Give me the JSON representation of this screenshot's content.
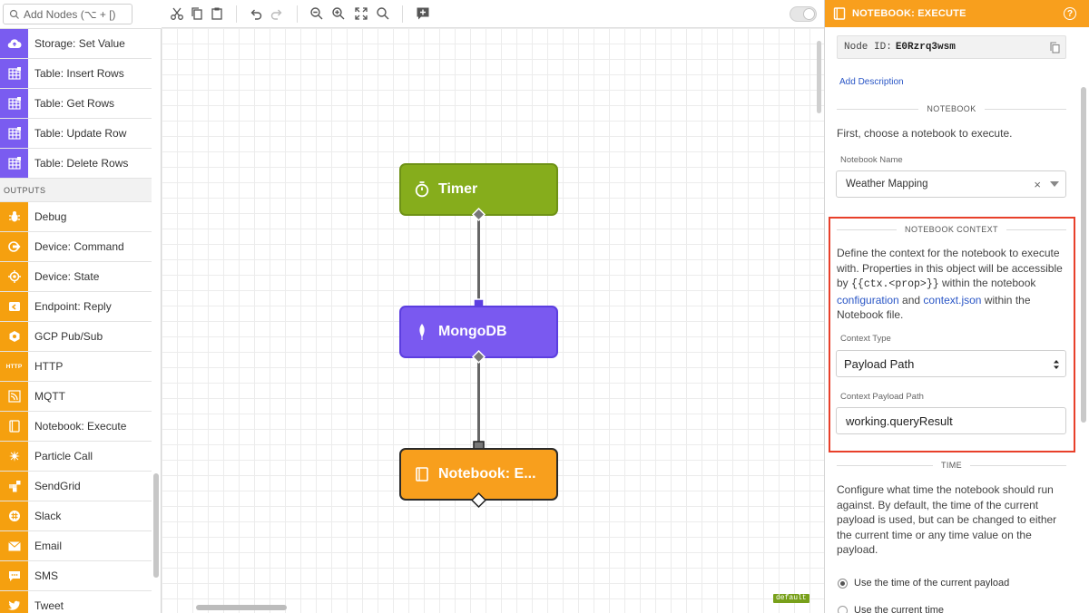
{
  "search": {
    "placeholder": "Add Nodes (⌥ + [)"
  },
  "palette": {
    "items_top": [
      {
        "label": "Storage: Set Value",
        "icon": "cloud-upload-icon",
        "color": "#7a5cf0"
      },
      {
        "label": "Table: Insert Rows",
        "icon": "table-icon",
        "color": "#7a5cf0"
      },
      {
        "label": "Table: Get Rows",
        "icon": "table-icon",
        "color": "#7a5cf0"
      },
      {
        "label": "Table: Update Row",
        "icon": "table-icon",
        "color": "#7a5cf0"
      },
      {
        "label": "Table: Delete Rows",
        "icon": "table-icon",
        "color": "#7a5cf0"
      }
    ],
    "section_outputs": "OUTPUTS",
    "items_outputs": [
      {
        "label": "Debug",
        "icon": "bug-icon",
        "color": "#f5a00f"
      },
      {
        "label": "Device: Command",
        "icon": "device-command-icon",
        "color": "#f5a00f"
      },
      {
        "label": "Device: State",
        "icon": "device-state-icon",
        "color": "#f5a00f"
      },
      {
        "label": "Endpoint: Reply",
        "icon": "reply-icon",
        "color": "#f5a00f"
      },
      {
        "label": "GCP Pub/Sub",
        "icon": "gcp-icon",
        "color": "#f5a00f"
      },
      {
        "label": "HTTP",
        "icon": "http-icon",
        "color": "#f5a00f"
      },
      {
        "label": "MQTT",
        "icon": "mqtt-icon",
        "color": "#f5a00f"
      },
      {
        "label": "Notebook: Execute",
        "icon": "notebook-icon",
        "color": "#f5a00f"
      },
      {
        "label": "Particle Call",
        "icon": "particle-icon",
        "color": "#f5a00f"
      },
      {
        "label": "SendGrid",
        "icon": "sendgrid-icon",
        "color": "#f5a00f"
      },
      {
        "label": "Slack",
        "icon": "slack-icon",
        "color": "#f5a00f"
      },
      {
        "label": "Email",
        "icon": "email-icon",
        "color": "#f5a00f"
      },
      {
        "label": "SMS",
        "icon": "sms-icon",
        "color": "#f5a00f"
      },
      {
        "label": "Tweet",
        "icon": "tweet-icon",
        "color": "#f5a00f"
      }
    ],
    "http_icon_text": "HTTP"
  },
  "toolbar": {
    "buttons": [
      "back-icon",
      "cut-icon",
      "copy-icon",
      "paste-icon",
      "undo-icon",
      "redo-icon",
      "zoom-out-icon",
      "zoom-in-icon",
      "fit-icon",
      "zoom-reset-icon",
      "add-comment-icon"
    ],
    "toggle_on": false
  },
  "canvas": {
    "nodes": [
      {
        "label": "Timer",
        "icon": "timer-icon",
        "color": "#86ad1c"
      },
      {
        "label": "MongoDB",
        "icon": "mongodb-leaf-icon",
        "color": "#7a59f0"
      },
      {
        "label": "Notebook: E...",
        "icon": "notebook-icon",
        "color": "#f89f1d"
      }
    ],
    "badge": "default"
  },
  "panel": {
    "title": "NOTEBOOK: EXECUTE",
    "accent": "#f89f1d",
    "node_id_label": "Node ID:",
    "node_id_value": "E0Rzrq3wsm",
    "add_description": "Add Description",
    "section_notebook": "NOTEBOOK",
    "notebook_intro": "First, choose a notebook to execute.",
    "notebook_name_label": "Notebook Name",
    "notebook_name_value": "Weather Mapping",
    "clear_glyph": "×",
    "section_context": "NOTEBOOK CONTEXT",
    "context_text_1": "Define the context for the notebook to execute with. Properties in this object will be accessible by ",
    "context_code": "{{ctx.<prop>}}",
    "context_text_2": " within the notebook ",
    "context_link_1": "configuration",
    "context_text_3": " and ",
    "context_link_2": "context.json",
    "context_text_4": " within the Notebook file.",
    "context_type_label": "Context Type",
    "context_type_value": "Payload Path",
    "context_path_label": "Context Payload Path",
    "context_path_value": "working.queryResult",
    "highlight_color": "#e8402a",
    "section_time": "TIME",
    "time_text": "Configure what time the notebook should run against. By default, the time of the current payload is used, but can be changed to either the current time or any time value on the payload.",
    "radio_1": "Use the time of the current payload",
    "radio_2": "Use the current time"
  }
}
